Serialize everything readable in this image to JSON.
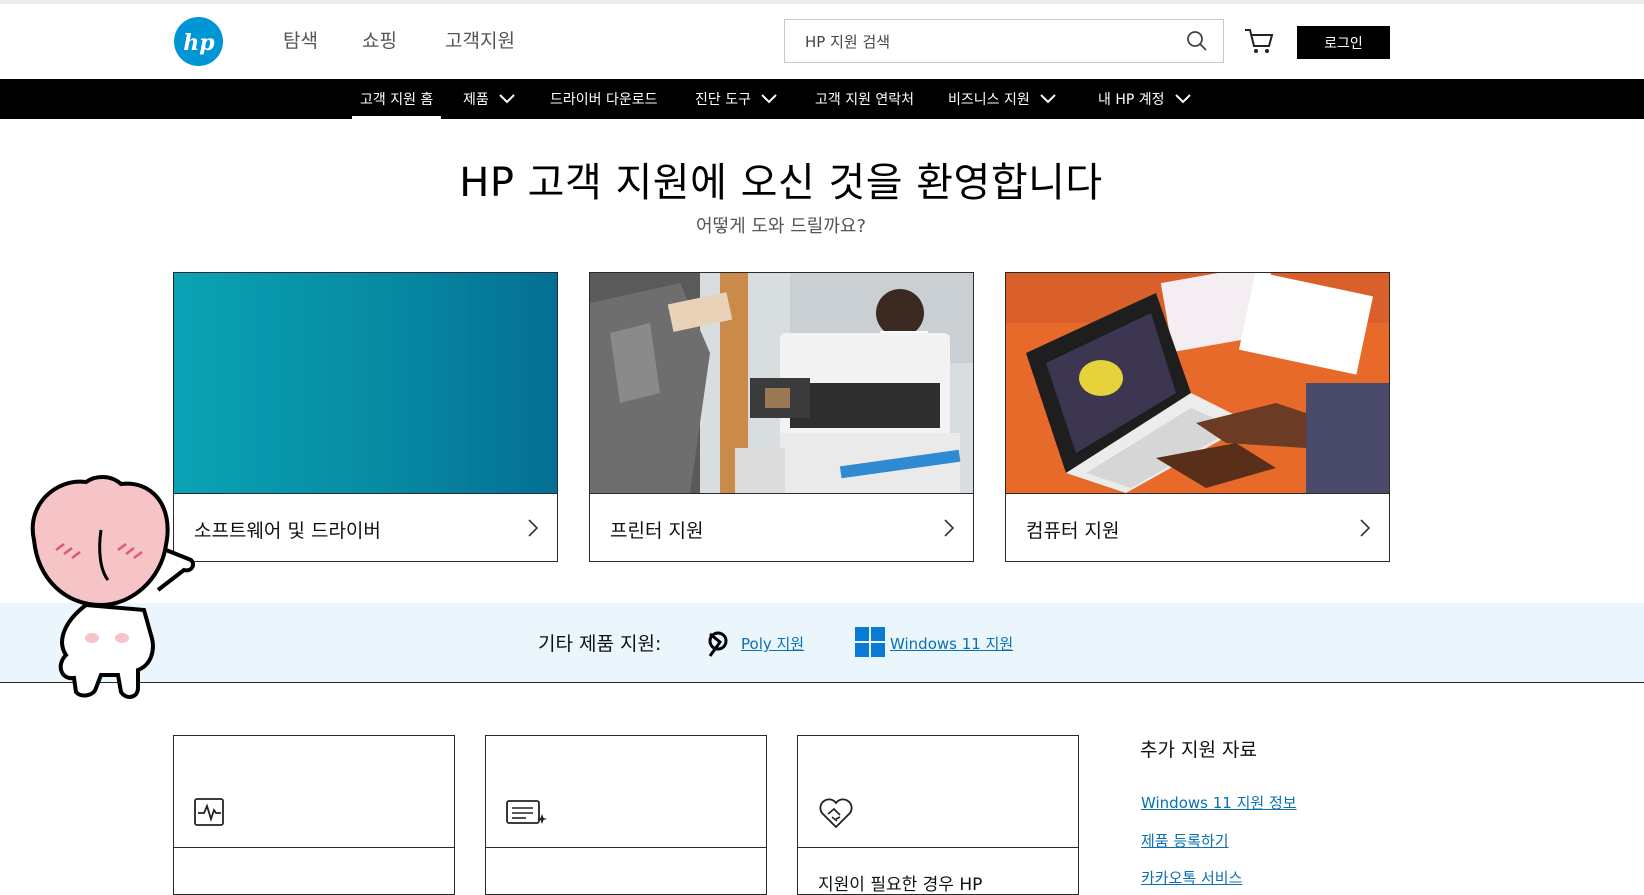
{
  "header": {
    "logo_text": "hp",
    "nav": [
      "탐색",
      "쇼핑",
      "고객지원"
    ],
    "search_placeholder": "HP 지원 검색",
    "login_label": "로그인"
  },
  "subnav": {
    "items": [
      {
        "label": "고객 지원 홈",
        "dropdown": false,
        "active": true
      },
      {
        "label": "제품",
        "dropdown": true
      },
      {
        "label": "드라이버 다운로드",
        "dropdown": false
      },
      {
        "label": "진단 도구",
        "dropdown": true
      },
      {
        "label": "고객 지원 연락처",
        "dropdown": false
      },
      {
        "label": "비즈니스 지원",
        "dropdown": true
      },
      {
        "label": "내 HP 계정",
        "dropdown": true
      }
    ]
  },
  "hero": {
    "title": "HP 고객 지원에 오신 것을 환영합니다",
    "subtitle": "어떻게 도와 드릴까요?"
  },
  "cards": [
    {
      "label": "소프트웨어 및 드라이버"
    },
    {
      "label": "프린터 지원"
    },
    {
      "label": "컴퓨터 지원"
    }
  ],
  "other_support": {
    "label": "기타 제품 지원:",
    "links": [
      "Poly 지원",
      "Windows 11 지원"
    ]
  },
  "tiles": [
    {
      "icon": "activity-monitor-icon",
      "text": ""
    },
    {
      "icon": "document-sparkle-icon",
      "text": ""
    },
    {
      "icon": "heart-handshake-icon",
      "text": "지원이 필요한 경우 HP"
    }
  ],
  "additional_resources": {
    "title": "추가 지원 자료",
    "links": [
      "Windows 11 지원 정보",
      "제품 등록하기",
      "카카오톡 서비스"
    ]
  },
  "colors": {
    "hp_blue": "#0096d6",
    "nav_black": "#000000",
    "link_blue": "#0a6fb3",
    "strip_bg": "#eaf6fb"
  }
}
